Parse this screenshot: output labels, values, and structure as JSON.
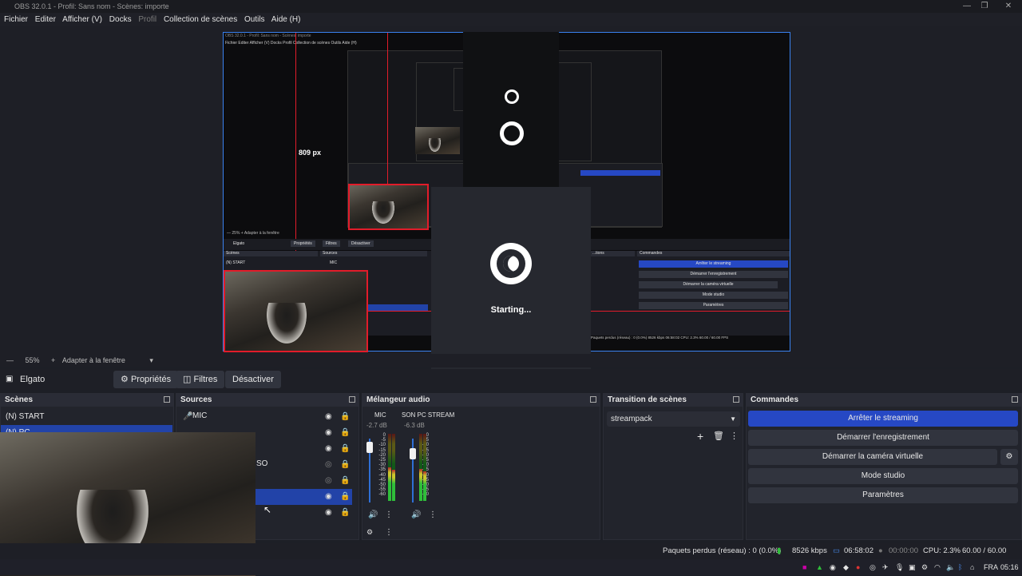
{
  "window": {
    "title": "OBS 32.0.1 - Profil: Sans nom - Scènes: importe",
    "min": "—",
    "max": "❐",
    "close": "✕"
  },
  "menu": {
    "items": [
      "Fichier",
      "Editer",
      "Afficher (V)",
      "Docks"
    ],
    "profil": "Profil",
    "items2": [
      "Collection de scènes",
      "Outils",
      "Aide (H)"
    ]
  },
  "preview": {
    "label_px": "809 px",
    "nested_menu": "Fichier   Editer   Afficher (V)   Docks   Profil   Collection de scènes   Outils   Aide (H)",
    "nested_title": "OBS 32.0.1 - Profil: Sans nom - Scènes: importe",
    "starting": "Starting...",
    "nested": {
      "zoom": "— 25%  +  Adapter à la fenêtre",
      "source": "Elgato",
      "props": "Propriétés",
      "filters": "Filtres",
      "deactivate": "Désactiver",
      "scenes_hd": "Scènes",
      "sources_hd": "Sources",
      "commands_hd": "Commandes",
      "transitions_hd": "...tions",
      "scene1": "(N) START",
      "src1": "MIC",
      "btn1": "Arrêter le streaming",
      "btn2": "Démarrer l'enregistrement",
      "btn3": "Démarrer la caméra virtuelle",
      "btn4": "Mode studio",
      "btn5": "Paramètres",
      "status": "Paquets perdus (réseau) : 0 (0.0%)    8526 kbps    06:58:02    CPU: 2.3%    60.00 / 60.00 FPS"
    }
  },
  "zoom": {
    "minus": "—",
    "value": "55%",
    "plus": "+",
    "fit": "Adapter à la fenêtre"
  },
  "sourcebar": {
    "name": "Elgato",
    "properties": "Propriétés",
    "filters": "Filtres",
    "deactivate": "Désactiver"
  },
  "scenes": {
    "title": "Scènes",
    "items": [
      "(N) START",
      "(N) PC"
    ]
  },
  "sources": {
    "title": "Sources",
    "items": [
      "MIC",
      "",
      "",
      "SO",
      "",
      "",
      ""
    ]
  },
  "mixer": {
    "title": "Mélangeur audio",
    "channels": [
      {
        "name": "MIC",
        "db": "-2.7 dB",
        "level": 0.5
      },
      {
        "name": "SON PC STREAM",
        "db": "-6.3 dB",
        "level": 0.45
      }
    ],
    "scale": [
      "0",
      "-5",
      "-10",
      "-15",
      "-20",
      "-25",
      "-30",
      "-35",
      "-40",
      "-45",
      "-50",
      "-55",
      "-60"
    ]
  },
  "transitions": {
    "title": "Transition de scènes",
    "selected": "streampack"
  },
  "commands": {
    "title": "Commandes",
    "stop_stream": "Arrêter le streaming",
    "start_rec": "Démarrer l'enregistrement",
    "virtual_cam": "Démarrer la caméra virtuelle",
    "studio": "Mode studio",
    "settings": "Paramètres"
  },
  "status": {
    "dropped": "Paquets perdus (réseau) : 0 (0.0%)",
    "bitrate": "8526 kbps",
    "stream_time": "06:58:02",
    "rec_time": "00:00:00",
    "cpu": "CPU: 2.3%",
    "fps": "60.00 / 60.00 FPS"
  },
  "taskbar": {
    "lang": "FRA",
    "time": "05:16"
  },
  "colors": {
    "accent": "#2648c4",
    "selection": "#2243a8",
    "red_guide": "#e21c2a",
    "frame": "#3a82f0"
  }
}
